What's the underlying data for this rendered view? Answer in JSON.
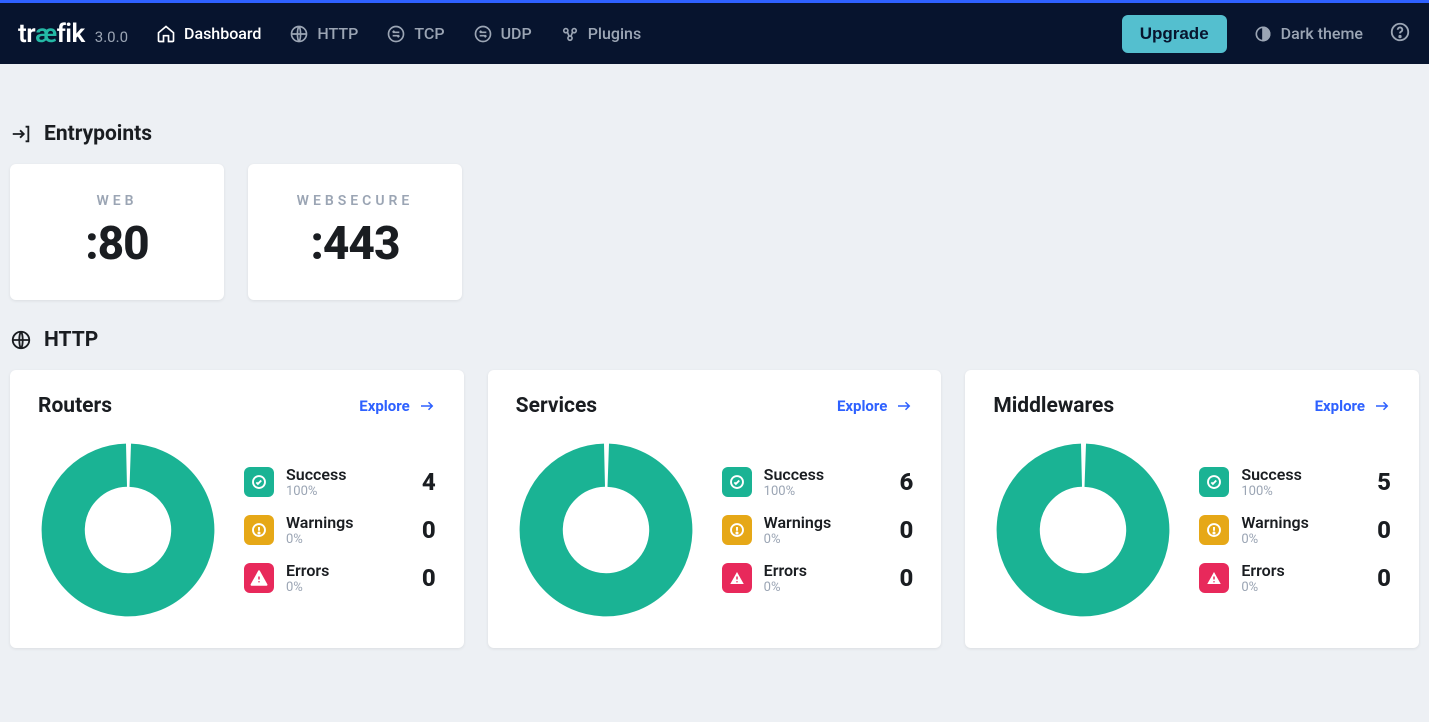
{
  "brand": {
    "pre": "tr",
    "ae": "æ",
    "post": "fik",
    "version": "3.0.0"
  },
  "nav": {
    "dashboard": "Dashboard",
    "http": "HTTP",
    "tcp": "TCP",
    "udp": "UDP",
    "plugins": "Plugins"
  },
  "right": {
    "upgrade": "Upgrade",
    "dark": "Dark theme"
  },
  "sections": {
    "entrypoints": "Entrypoints",
    "http": "HTTP"
  },
  "entrypoints": [
    {
      "name": "WEB",
      "port": ":80"
    },
    {
      "name": "WEBSECURE",
      "port": ":443"
    }
  ],
  "explore": "Explore",
  "legend": {
    "success": "Success",
    "warnings": "Warnings",
    "errors": "Errors"
  },
  "http_cards": {
    "routers": {
      "title": "Routers",
      "success_pct": "100%",
      "success_count": "4",
      "warn_pct": "0%",
      "warn_count": "0",
      "err_pct": "0%",
      "err_count": "0"
    },
    "services": {
      "title": "Services",
      "success_pct": "100%",
      "success_count": "6",
      "warn_pct": "0%",
      "warn_count": "0",
      "err_pct": "0%",
      "err_count": "0"
    },
    "middlewares": {
      "title": "Middlewares",
      "success_pct": "100%",
      "success_count": "5",
      "warn_pct": "0%",
      "warn_count": "0",
      "err_pct": "0%",
      "err_count": "0"
    }
  },
  "chart_data": [
    {
      "type": "pie",
      "title": "Routers",
      "categories": [
        "Success",
        "Warnings",
        "Errors"
      ],
      "values": [
        4,
        0,
        0
      ]
    },
    {
      "type": "pie",
      "title": "Services",
      "categories": [
        "Success",
        "Warnings",
        "Errors"
      ],
      "values": [
        6,
        0,
        0
      ]
    },
    {
      "type": "pie",
      "title": "Middlewares",
      "categories": [
        "Success",
        "Warnings",
        "Errors"
      ],
      "values": [
        5,
        0,
        0
      ]
    }
  ],
  "colors": {
    "success": "#1ab394",
    "warn": "#e6a817",
    "error": "#e8295b",
    "accent": "#2e61ff"
  }
}
